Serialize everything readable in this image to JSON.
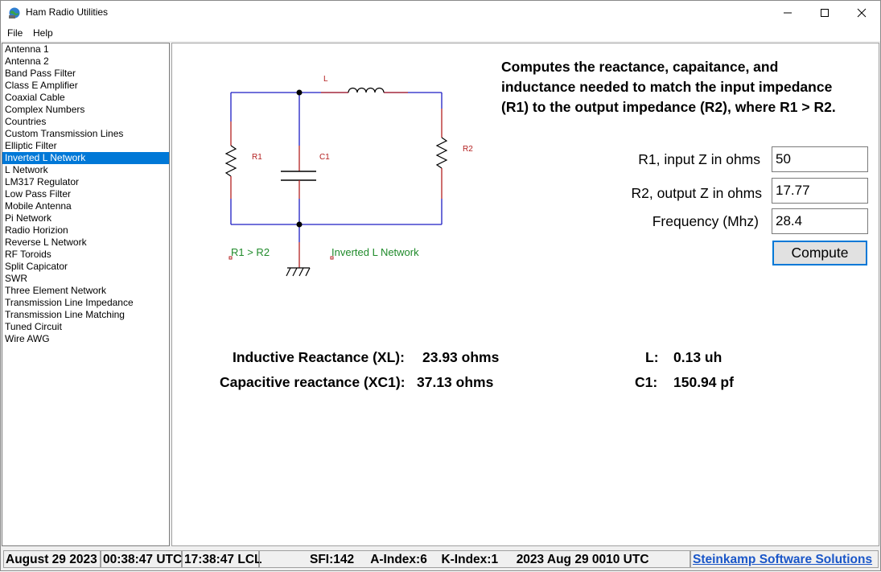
{
  "window": {
    "title": "Ham Radio Utilities",
    "icon": "globe-app-icon",
    "controls": [
      "minimize-icon",
      "maximize-icon",
      "close-icon"
    ]
  },
  "menu": {
    "file": "File",
    "help": "Help"
  },
  "sidebar": {
    "items": [
      "Antenna 1",
      "Antenna 2",
      "Band Pass Filter",
      "Class E Amplifier",
      "Coaxial Cable",
      "Complex Numbers",
      "Countries",
      "Custom Transmission Lines",
      "Elliptic Filter",
      "Inverted L Network",
      "L Network",
      "LM317 Regulator",
      "Low Pass Filter",
      "Mobile Antenna",
      "Pi Network",
      "Radio Horizion",
      "Reverse L Network",
      "RF Toroids",
      "Split Capicator",
      "SWR",
      "Three Element Network",
      "Transmission Line Impedance",
      "Transmission Line Matching",
      "Tuned Circuit",
      "Wire AWG"
    ],
    "selected": "Inverted L Network"
  },
  "schematic": {
    "label_L": "L",
    "label_R1": "R1",
    "label_C1": "C1",
    "label_R2": "R2",
    "condition": "R1 > R2",
    "name": "Inverted L Network",
    "colors": {
      "wire": "#1c1cc4",
      "component": "#b42020",
      "label_red": "#b42020",
      "label_green": "#1f8a2a"
    }
  },
  "description": "Computes the reactance, capaitance, and inductance needed to match the input impedance (R1) to the output impedance (R2), where R1 > R2.",
  "form": {
    "r1_label": "R1, input Z in ohms",
    "r1_value": "50",
    "r2_label": "R2, output Z in ohms",
    "r2_value": "17.77",
    "freq_label": "Frequency (Mhz)",
    "freq_value": "28.4",
    "compute_label": "Compute"
  },
  "results": {
    "xl_label": "Inductive Reactance (XL):",
    "xl_value": "23.93 ohms",
    "xc1_label": "Capacitive reactance (XC1):",
    "xc1_value": "37.13 ohms",
    "l_label": "L:",
    "l_value": "0.13 uh",
    "c1_label": "C1:",
    "c1_value": "150.94 pf"
  },
  "status": {
    "date": "August 29 2023",
    "utc": "00:38:47 UTC",
    "local": "17:38:47 LCL",
    "sfi": "SFI:142",
    "a_index": "A-Index:6",
    "k_index": "K-Index:1",
    "solar_time": "2023 Aug 29 0010 UTC",
    "link": "Steinkamp Software Solutions"
  }
}
